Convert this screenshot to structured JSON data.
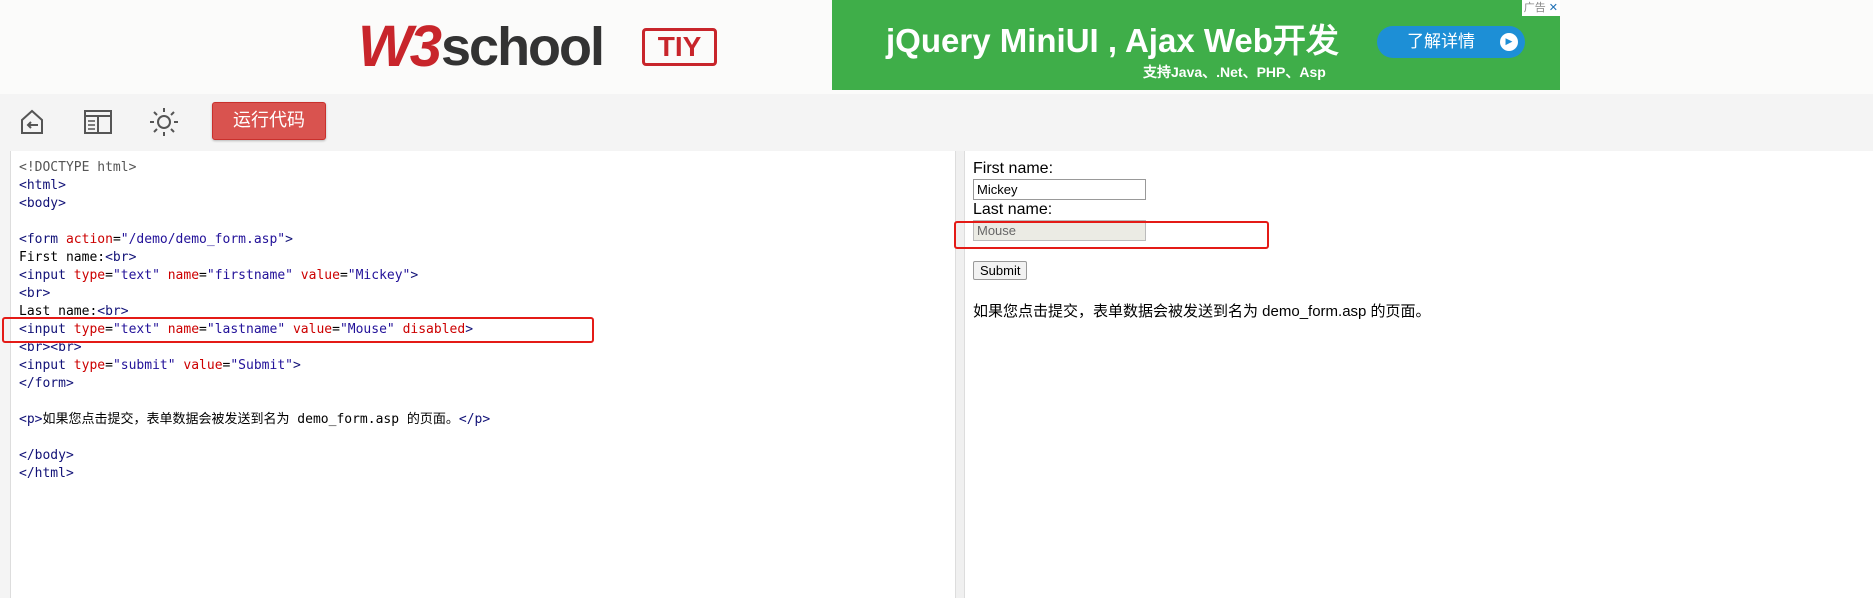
{
  "header": {
    "logo_w3": "W3",
    "logo_school": "school",
    "logo_tiy": "TIY"
  },
  "ad": {
    "title": "jQuery MiniUI , Ajax Web开发",
    "subtitle": "支持Java、.Net、PHP、Asp",
    "button_label": "了解详情",
    "ad_label": "广告",
    "close_glyph": "✕",
    "colors": {
      "background": "#3fae49",
      "button": "#1d8fd6"
    }
  },
  "toolbar": {
    "run_label": "运行代码",
    "icons": [
      "back-icon",
      "layout-icon",
      "brightness-icon"
    ],
    "colors": {
      "run": "#d9534f"
    }
  },
  "code": {
    "l1": "<!DOCTYPE html>",
    "l2": "<html>",
    "l3": "<body>",
    "l5_open": "<form",
    "l5_attr": "action",
    "l5_val": "\"/demo/demo_form.asp\"",
    "l6_text": "First name:",
    "l6_br": "<br>",
    "l7_tag": "<input",
    "l7_a1": "type",
    "l7_v1": "\"text\"",
    "l7_a2": "name",
    "l7_v2": "\"firstname\"",
    "l7_a3": "value",
    "l7_v3": "\"Mickey\"",
    "l8": "<br>",
    "l9_text": "Last name:",
    "l9_br": "<br>",
    "l10_tag": "<input",
    "l10_a1": "type",
    "l10_v1": "\"text\"",
    "l10_a2": "name",
    "l10_v2": "\"lastname\"",
    "l10_a3": "value",
    "l10_v3": "\"Mouse\"",
    "l10_a4": "disabled",
    "l11": "<br><br>",
    "l12_tag": "<input",
    "l12_a1": "type",
    "l12_v1": "\"submit\"",
    "l12_a2": "value",
    "l12_v2": "\"Submit\"",
    "l13": "</form>",
    "l15_open": "<p>",
    "l15_text": "如果您点击提交，表单数据会被发送到名为 demo_form.asp 的页面。",
    "l15_close": "</p>",
    "l17": "</body>",
    "l18": "</html>"
  },
  "result": {
    "first_label": "First name:",
    "first_value": "Mickey",
    "last_label": "Last name:",
    "last_value": "Mouse",
    "submit_label": "Submit",
    "paragraph": "如果您点击提交，表单数据会被发送到名为 demo_form.asp 的页面。"
  },
  "highlight_color": "#e41b17"
}
